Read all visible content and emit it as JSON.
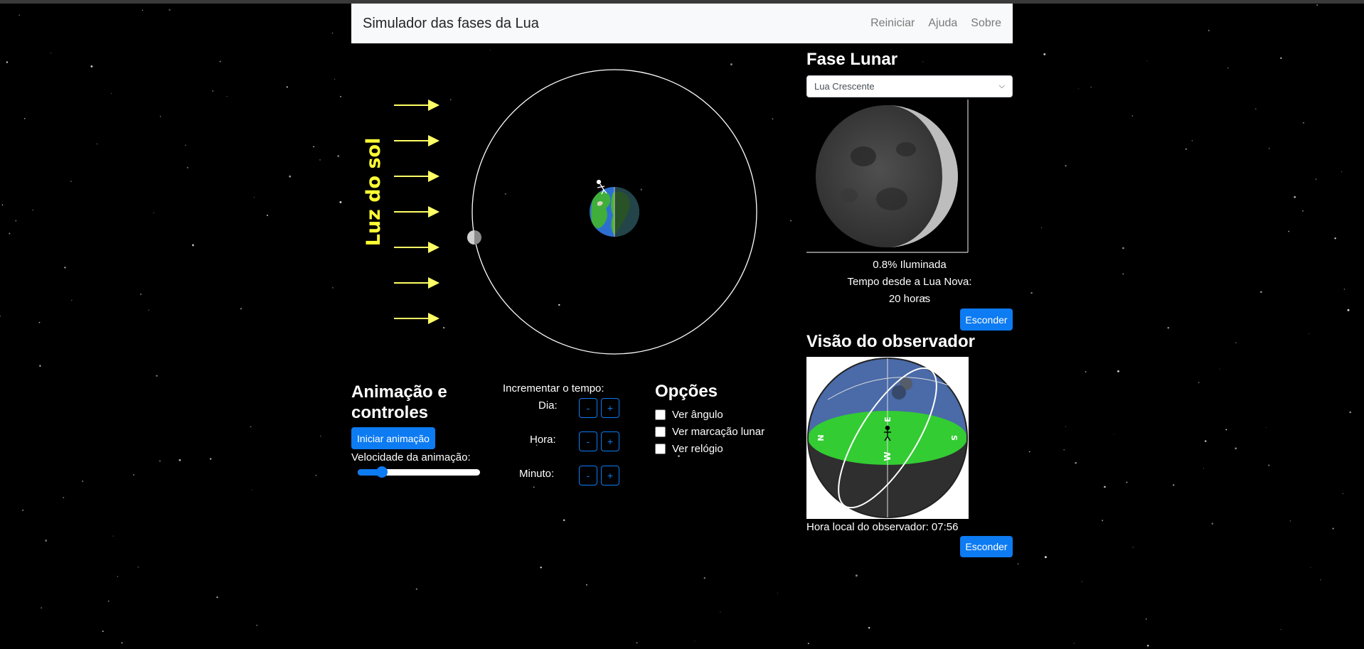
{
  "navbar": {
    "brand": "Simulador das fases da Lua",
    "links": [
      "Reiniciar",
      "Ajuda",
      "Sobre"
    ]
  },
  "scene": {
    "sunlight_label": "Luz do sol"
  },
  "phase_panel": {
    "title": "Fase Lunar",
    "selected_phase": "Lua Crescente",
    "illumination": "0.8% Iluminada",
    "time_since_label": "Tempo desde a Lua Nova:",
    "time_since_value": "20 horas",
    "hide_label": "Esconder"
  },
  "observer_panel": {
    "title": "Visão do observador",
    "local_time": "Hora local do observador: 07:56",
    "hide_label": "Esconder",
    "compass": [
      "E",
      "N",
      "S",
      "W"
    ]
  },
  "animation": {
    "title_line1": "Animação e",
    "title_line2": "controles",
    "start_label": "Iniciar animação",
    "speed_label": "Velocidade da animação:",
    "speed_fraction": 0.2
  },
  "increment": {
    "title": "Incrementar o tempo:",
    "rows": [
      {
        "label": "Dia:",
        "minus": "-",
        "plus": "+"
      },
      {
        "label": "Hora:",
        "minus": "-",
        "plus": "+"
      },
      {
        "label": "Minuto:",
        "minus": "-",
        "plus": "+"
      }
    ]
  },
  "options": {
    "title": "Opções",
    "items": [
      "Ver ângulo",
      "Ver marcação lunar",
      "Ver relógio"
    ]
  },
  "colors": {
    "accent": "#0d7bf2",
    "sunlight": "#ffff66",
    "horizon": "#33cc33",
    "sky": "#4a6aa8"
  }
}
